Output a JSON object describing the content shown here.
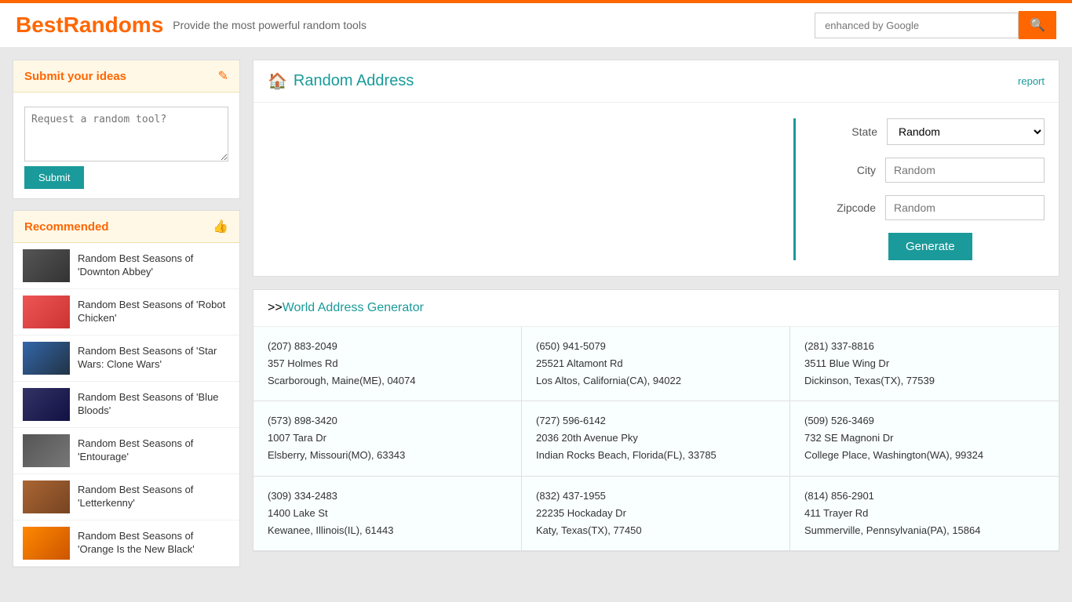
{
  "header": {
    "site_title": "BestRandoms",
    "tagline": "Provide the most powerful random tools",
    "search_placeholder": "enhanced by Google",
    "search_btn_icon": "🔍"
  },
  "sidebar": {
    "ideas_section_title": "Submit your ideas",
    "ideas_icon": "✏",
    "ideas_placeholder": "Request a random tool?",
    "submit_label": "Submit",
    "recommended_title": "Recommended",
    "recommended_icon": "👍",
    "rec_items": [
      {
        "title": "Random Best Seasons of 'Downton Abbey'",
        "thumb_class": "thumb-downton"
      },
      {
        "title": "Random Best Seasons of 'Robot Chicken'",
        "thumb_class": "thumb-robot"
      },
      {
        "title": "Random Best Seasons of 'Star Wars: Clone Wars'",
        "thumb_class": "thumb-starwars"
      },
      {
        "title": "Random Best Seasons of 'Blue Bloods'",
        "thumb_class": "thumb-bluebloods"
      },
      {
        "title": "Random Best Seasons of 'Entourage'",
        "thumb_class": "thumb-entourage"
      },
      {
        "title": "Random Best Seasons of 'Letterkenny'",
        "thumb_class": "thumb-letterkenny"
      },
      {
        "title": "Random Best Seasons of 'Orange Is the New Black'",
        "thumb_class": "thumb-orange"
      }
    ]
  },
  "main": {
    "card_title": "Random Address",
    "report_label": "report",
    "home_icon": "🏠",
    "state_label": "State",
    "city_label": "City",
    "zipcode_label": "Zipcode",
    "state_default": "Random",
    "city_placeholder": "Random",
    "zipcode_placeholder": "Random",
    "generate_label": "Generate",
    "world_section": ">>",
    "world_link": "World Address Generator",
    "addresses": [
      {
        "phone": "(207) 883-2049",
        "street": "357 Holmes Rd",
        "location": "Scarborough, Maine(ME), 04074"
      },
      {
        "phone": "(650) 941-5079",
        "street": "25521 Altamont Rd",
        "location": "Los Altos, California(CA), 94022"
      },
      {
        "phone": "(281) 337-8816",
        "street": "3511 Blue Wing Dr",
        "location": "Dickinson, Texas(TX), 77539"
      },
      {
        "phone": "(573) 898-3420",
        "street": "1007 Tara Dr",
        "location": "Elsberry, Missouri(MO), 63343"
      },
      {
        "phone": "(727) 596-6142",
        "street": "2036 20th Avenue Pky",
        "location": "Indian Rocks Beach, Florida(FL), 33785"
      },
      {
        "phone": "(509) 526-3469",
        "street": "732 SE Magnoni Dr",
        "location": "College Place, Washington(WA), 99324"
      },
      {
        "phone": "(309) 334-2483",
        "street": "1400 Lake St",
        "location": "Kewanee, Illinois(IL), 61443"
      },
      {
        "phone": "(832) 437-1955",
        "street": "22235 Hockaday Dr",
        "location": "Katy, Texas(TX), 77450"
      },
      {
        "phone": "(814) 856-2901",
        "street": "411 Trayer Rd",
        "location": "Summerville, Pennsylvania(PA), 15864"
      }
    ]
  }
}
